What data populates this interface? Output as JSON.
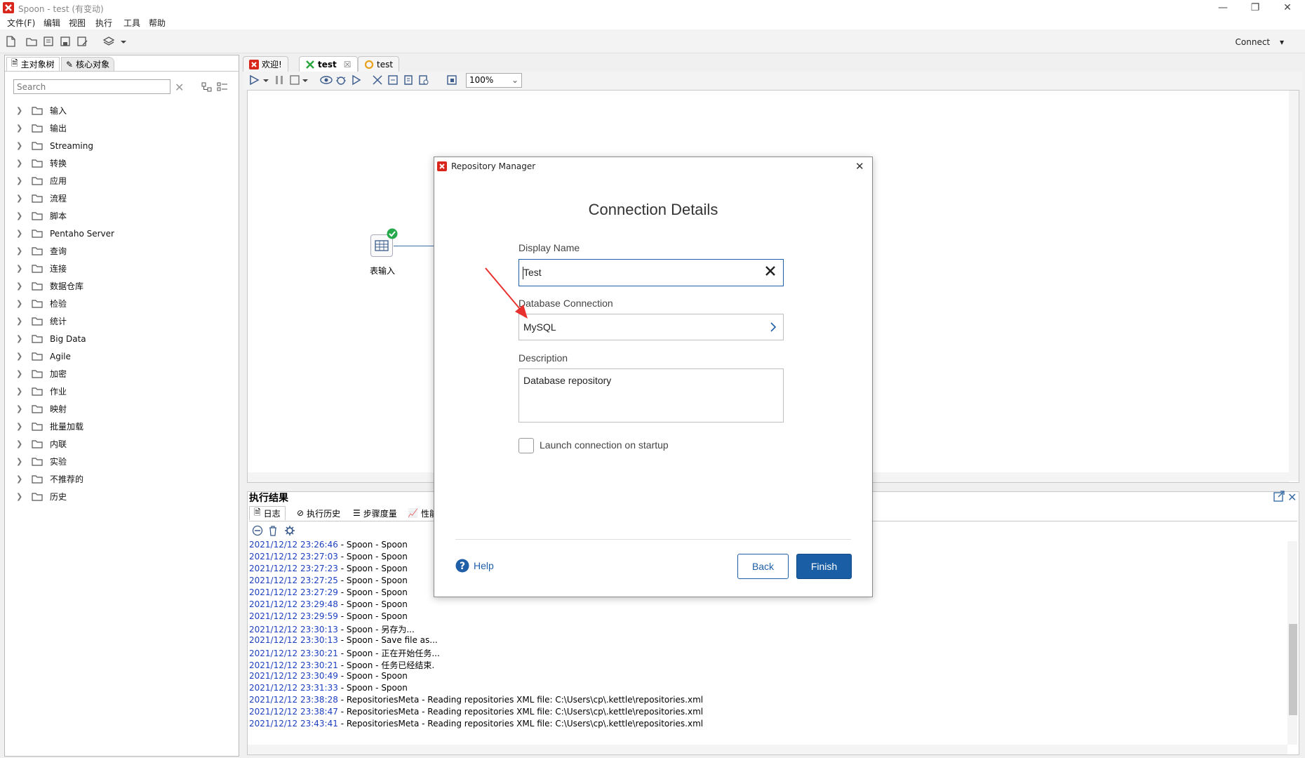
{
  "window": {
    "title": "Spoon - test (有变动)"
  },
  "menu": [
    "文件(F)",
    "编辑",
    "视图",
    "执行",
    "工具",
    "帮助"
  ],
  "toolbar": {
    "connect_label": "Connect"
  },
  "left_panel": {
    "tabs": [
      "主对象树",
      "核心对象"
    ],
    "search_placeholder": "Search",
    "tree": [
      "输入",
      "输出",
      "Streaming",
      "转换",
      "应用",
      "流程",
      "脚本",
      "Pentaho Server",
      "查询",
      "连接",
      "数据仓库",
      "检验",
      "统计",
      "Big Data",
      "Agile",
      "加密",
      "作业",
      "映射",
      "批量加载",
      "内联",
      "实验",
      "不推荐的",
      "历史"
    ]
  },
  "editor": {
    "tabs": [
      "欢迎!",
      "test",
      "test"
    ],
    "zoom": "100%",
    "step_label": "表输入"
  },
  "exec": {
    "title": "执行结果",
    "tabs": [
      "日志",
      "执行历史",
      "步骤度量",
      "性能"
    ],
    "log": [
      {
        "ts": "2021/12/12 23:26:46",
        "msg": " - Spoon - Spoon"
      },
      {
        "ts": "2021/12/12 23:27:03",
        "msg": " - Spoon - Spoon"
      },
      {
        "ts": "2021/12/12 23:27:23",
        "msg": " - Spoon - Spoon"
      },
      {
        "ts": "2021/12/12 23:27:25",
        "msg": " - Spoon - Spoon"
      },
      {
        "ts": "2021/12/12 23:27:29",
        "msg": " - Spoon - Spoon"
      },
      {
        "ts": "2021/12/12 23:29:48",
        "msg": " - Spoon - Spoon"
      },
      {
        "ts": "2021/12/12 23:29:59",
        "msg": " - Spoon - Spoon"
      },
      {
        "ts": "2021/12/12 23:30:13",
        "msg": " - Spoon - 另存为..."
      },
      {
        "ts": "2021/12/12 23:30:13",
        "msg": " - Spoon - Save file as..."
      },
      {
        "ts": "2021/12/12 23:30:21",
        "msg": " - Spoon - 正在开始任务..."
      },
      {
        "ts": "2021/12/12 23:30:21",
        "msg": " - Spoon - 任务已经结束."
      },
      {
        "ts": "2021/12/12 23:30:49",
        "msg": " - Spoon - Spoon"
      },
      {
        "ts": "2021/12/12 23:31:33",
        "msg": " - Spoon - Spoon"
      },
      {
        "ts": "2021/12/12 23:38:28",
        "msg": " - RepositoriesMeta - Reading repositories XML file: C:\\Users\\cp\\.kettle\\repositories.xml"
      },
      {
        "ts": "2021/12/12 23:38:47",
        "msg": " - RepositoriesMeta - Reading repositories XML file: C:\\Users\\cp\\.kettle\\repositories.xml"
      },
      {
        "ts": "2021/12/12 23:43:41",
        "msg": " - RepositoriesMeta - Reading repositories XML file: C:\\Users\\cp\\.kettle\\repositories.xml"
      }
    ]
  },
  "dialog": {
    "title": "Repository Manager",
    "heading": "Connection Details",
    "display_name_label": "Display Name",
    "display_name_value": "Test",
    "db_conn_label": "Database Connection",
    "db_conn_value": "MySQL",
    "description_label": "Description",
    "description_value": "Database repository",
    "checkbox_label": "Launch connection on startup",
    "help_label": "Help",
    "back_label": "Back",
    "finish_label": "Finish"
  },
  "colors": {
    "accent": "#1a5fa6",
    "log_timestamp": "#1c3fbf",
    "annotation_arrow": "#e8312f"
  }
}
